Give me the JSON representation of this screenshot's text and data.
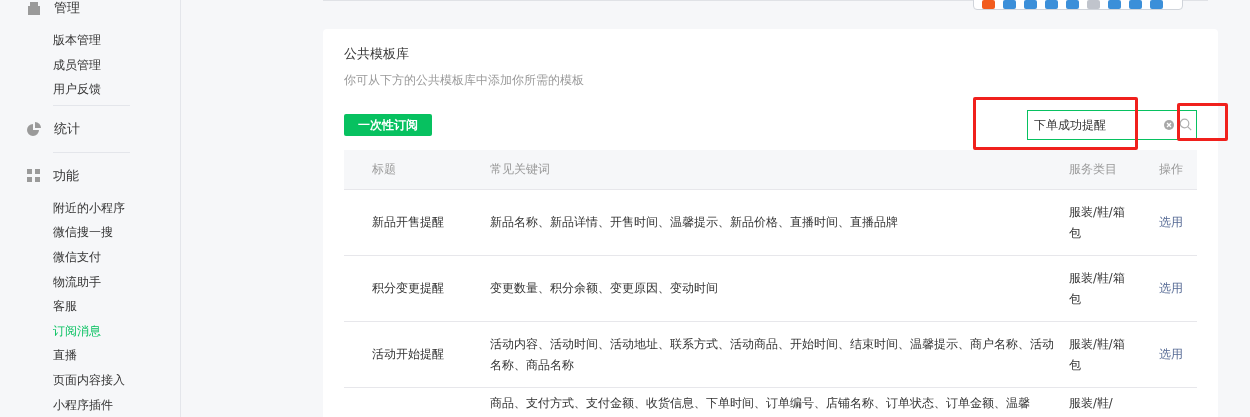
{
  "sidebar": {
    "groups": [
      {
        "kind": "manage",
        "label": "管理",
        "items": [
          {
            "label": "版本管理",
            "selected": false
          },
          {
            "label": "成员管理",
            "selected": false
          },
          {
            "label": "用户反馈",
            "selected": false
          }
        ]
      },
      {
        "kind": "stats",
        "label": "统计"
      },
      {
        "kind": "features",
        "label": "功能",
        "items": [
          {
            "label": "附近的小程序",
            "selected": false
          },
          {
            "label": "微信搜一搜",
            "selected": false
          },
          {
            "label": "微信支付",
            "selected": false
          },
          {
            "label": "物流助手",
            "selected": false
          },
          {
            "label": "客服",
            "selected": false
          },
          {
            "label": "订阅消息",
            "selected": true
          },
          {
            "label": "直播",
            "selected": false
          },
          {
            "label": "页面内容接入",
            "selected": false
          },
          {
            "label": "小程序插件",
            "selected": false
          }
        ]
      }
    ]
  },
  "library": {
    "title": "公共模板库",
    "subtitle": "你可从下方的公共模板库中添加你所需的模板",
    "button": "一次性订阅",
    "search": {
      "value": "下单成功提醒"
    },
    "table": {
      "columns": [
        "标题",
        "常见关键词",
        "服务类目",
        "操作"
      ],
      "rows": [
        {
          "title": "新品开售提醒",
          "keywords": "新品名称、新品详情、开售时间、温馨提示、新品价格、直播时间、直播品牌",
          "category": "服装/鞋/箱包",
          "action": "选用"
        },
        {
          "title": "积分变更提醒",
          "keywords": "变更数量、积分余额、变更原因、变动时间",
          "category": "服装/鞋/箱包",
          "action": "选用"
        },
        {
          "title": "活动开始提醒",
          "keywords": "活动内容、活动时间、活动地址、联系方式、活动商品、开始时间、结束时间、温馨提示、商户名称、活动名称、商品名称",
          "category": "服装/鞋/箱包",
          "action": "选用"
        },
        {
          "keywords": "商品、支付方式、支付金额、收货信息、下单时间、订单编号、店铺名称、订单状态、订单金额、温馨",
          "category": "服装/鞋/"
        }
      ]
    }
  }
}
